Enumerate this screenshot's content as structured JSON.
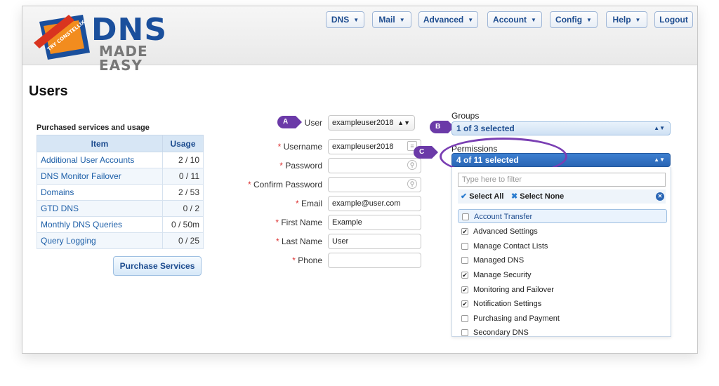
{
  "logo": {
    "word": "DNS",
    "sub": "MADE EASY",
    "ribbon": "TRY CONSTELLIX"
  },
  "nav": [
    "DNS",
    "Mail",
    "Advanced",
    "Account",
    "Config",
    "Help",
    "Logout"
  ],
  "page": {
    "title": "Users"
  },
  "services": {
    "title": "Purchased services and usage",
    "headers": [
      "Item",
      "Usage"
    ],
    "rows": [
      [
        "Additional User Accounts",
        "2 / 10"
      ],
      [
        "DNS Monitor Failover",
        "0 / 11"
      ],
      [
        "Domains",
        "2 / 53"
      ],
      [
        "GTD DNS",
        "0 / 2"
      ],
      [
        "Monthly DNS Queries",
        "0 / 50m"
      ],
      [
        "Query Logging",
        "0 / 25"
      ]
    ],
    "purchase_label": "Purchase Services"
  },
  "form": {
    "user": {
      "label": "User",
      "value": "exampleuser2018"
    },
    "username": {
      "label": "Username",
      "value": "exampleuser2018"
    },
    "password": {
      "label": "Password",
      "value": ""
    },
    "confirm": {
      "label": "Confirm Password",
      "value": ""
    },
    "email": {
      "label": "Email",
      "value": "example@user.com"
    },
    "first": {
      "label": "First Name",
      "value": "Example"
    },
    "last": {
      "label": "Last Name",
      "value": "User"
    },
    "phone": {
      "label": "Phone",
      "value": ""
    }
  },
  "badges": {
    "a": "A",
    "b": "B",
    "c": "C"
  },
  "groups": {
    "label": "Groups",
    "selected": "1 of 3 selected"
  },
  "permissions": {
    "label": "Permissions",
    "selected": "4 of 11 selected",
    "filter_placeholder": "Type here to filter",
    "select_all": "Select All",
    "select_none": "Select None",
    "items": [
      {
        "label": "Account Transfer",
        "checked": false
      },
      {
        "label": "Advanced Settings",
        "checked": true
      },
      {
        "label": "Manage Contact Lists",
        "checked": false
      },
      {
        "label": "Managed DNS",
        "checked": false
      },
      {
        "label": "Manage Security",
        "checked": true
      },
      {
        "label": "Monitoring and Failover",
        "checked": true
      },
      {
        "label": "Notification Settings",
        "checked": true
      },
      {
        "label": "Purchasing and Payment",
        "checked": false
      },
      {
        "label": "Secondary DNS",
        "checked": false
      }
    ]
  },
  "colors": {
    "accent": "#1d4c8f",
    "annotation": "#6b3aa8"
  }
}
